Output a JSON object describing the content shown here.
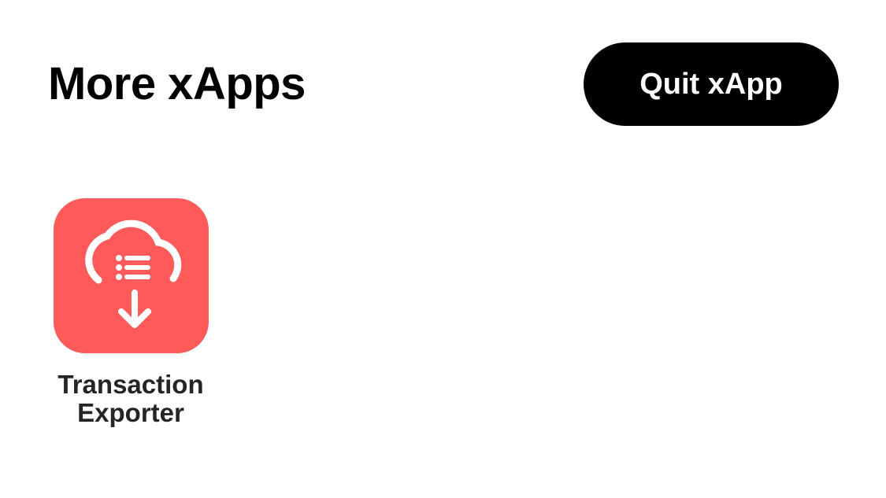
{
  "header": {
    "title": "More xApps",
    "quit_label": "Quit xApp"
  },
  "apps": [
    {
      "name": "Transaction Exporter",
      "icon": "cloud-download-list-icon",
      "icon_color": "#FF5A5A"
    }
  ],
  "colors": {
    "background": "#FFFFFF",
    "button": "#000000",
    "button_text": "#FFFFFF",
    "text": "#222628"
  }
}
